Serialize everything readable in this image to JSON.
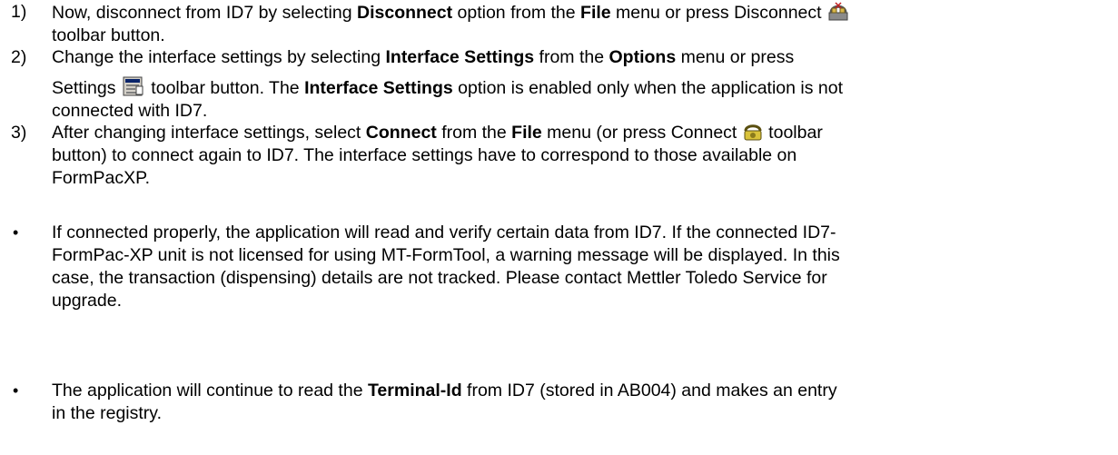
{
  "steps": [
    {
      "number": "1)",
      "l1": [
        "Now, disconnect from ID7 by selecting ",
        "Disconnect",
        " option from the ",
        "File",
        " menu or press Disconnect "
      ],
      "l2": "toolbar button."
    },
    {
      "number": "2)",
      "l1": [
        "Change the interface settings by selecting ",
        "Interface Settings",
        " from the ",
        "Options",
        " menu or press"
      ],
      "l2": [
        "Settings ",
        " toolbar button. The ",
        "Interface Settings",
        " option is enabled only when the application is not"
      ],
      "l3": "connected with ID7."
    },
    {
      "number": "3)",
      "l1": [
        "After changing interface settings, select ",
        "Connect",
        " from the ",
        "File",
        " menu (or press Connect ",
        " toolbar"
      ],
      "l2": "button) to connect again to ID7. The interface settings have to correspond to those available on",
      "l3": "FormPacXP."
    }
  ],
  "bullets": [
    {
      "marker": "•",
      "lines": [
        "If connected properly, the application will read and verify certain data from ID7. If the connected ID7-",
        "FormPac-XP unit is not licensed for using MT-FormTool, a warning message will be displayed. In this",
        "case, the transaction (dispensing) details are not tracked. Please contact Mettler Toledo Service for",
        "upgrade."
      ]
    },
    {
      "marker": "•",
      "l1": [
        "The application will continue to read the ",
        "Terminal-Id",
        " from ID7 (stored in AB004) and makes an entry"
      ],
      "l2": "in the registry."
    }
  ],
  "icons": {
    "disconnect": "disconnect-toolbar-icon",
    "settings": "settings-toolbar-icon",
    "connect": "connect-toolbar-icon"
  }
}
